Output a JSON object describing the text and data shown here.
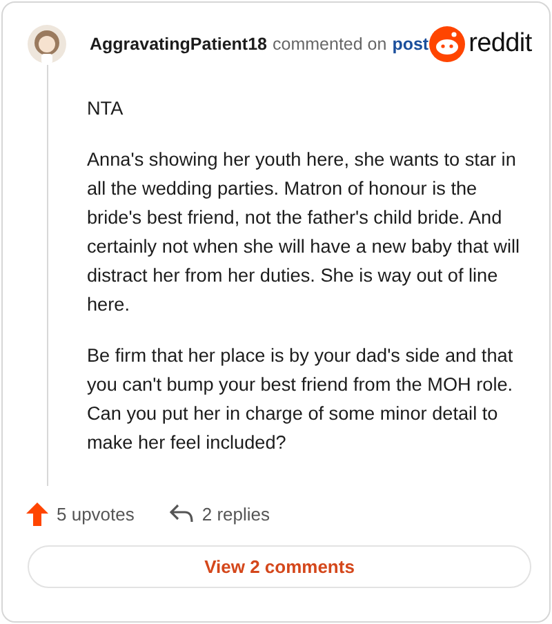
{
  "comment": {
    "author": "AggravatingPatient18",
    "action": "commented on",
    "target": "post",
    "logo_text": "reddit",
    "paragraphs": [
      "NTA",
      "Anna's showing her youth here, she wants to star in all the wedding parties. Matron of honour is the bride's best friend, not the father's child bride. And certainly not when she will have a new baby that will distract her from her duties. She is way out of line here.",
      "Be firm that her place is by your dad's side and that you can't bump your best friend from the MOH role. Can you put her in charge of some minor detail to make her feel included?"
    ],
    "upvotes": "5 upvotes",
    "replies": "2 replies"
  },
  "button": "View 2 comments"
}
